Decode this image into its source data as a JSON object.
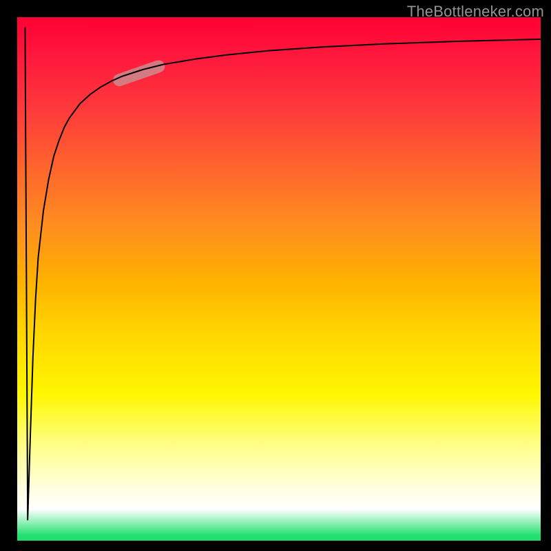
{
  "watermark": "TheBottleneker.com",
  "colors": {
    "gradient_top": "#ff0033",
    "gradient_mid": "#fff700",
    "gradient_bottom": "#22e06f",
    "curve": "#000000",
    "marker": "#c98f8f",
    "frame": "#000000"
  },
  "chart_data": {
    "type": "line",
    "title": "",
    "xlabel": "",
    "ylabel": "",
    "xlim": [
      0,
      100
    ],
    "ylim": [
      0,
      100
    ],
    "grid": false,
    "legend": false,
    "description": "Bottleneck-style curve: vertical drop near x≈2 from ~98 down to ~4, then rises steeply and asymptotically approaches ~96 across x; background is a vertical red→orange→yellow→white→green gradient.",
    "series": [
      {
        "name": "curve",
        "x": [
          1.5,
          2.0,
          2.5,
          3.0,
          3.5,
          4.0,
          5.0,
          6.0,
          7.0,
          8.0,
          9.0,
          10.0,
          12.0,
          14.0,
          16.0,
          18.0,
          20.0,
          24.0,
          28.0,
          34.0,
          40.0,
          48.0,
          58.0,
          70.0,
          84.0,
          100.0
        ],
        "y": [
          98.0,
          4.0,
          20.0,
          35.0,
          46.0,
          54.0,
          63.0,
          69.0,
          73.5,
          76.5,
          79.0,
          80.8,
          83.5,
          85.3,
          86.7,
          87.8,
          88.7,
          90.0,
          91.0,
          92.0,
          92.8,
          93.6,
          94.3,
          94.9,
          95.4,
          95.8
        ]
      }
    ],
    "marker": {
      "description": "Short pale pill-shaped highlight on the curve",
      "x_range": [
        19.5,
        27.0
      ],
      "y_range": [
        88.0,
        90.6
      ]
    }
  }
}
